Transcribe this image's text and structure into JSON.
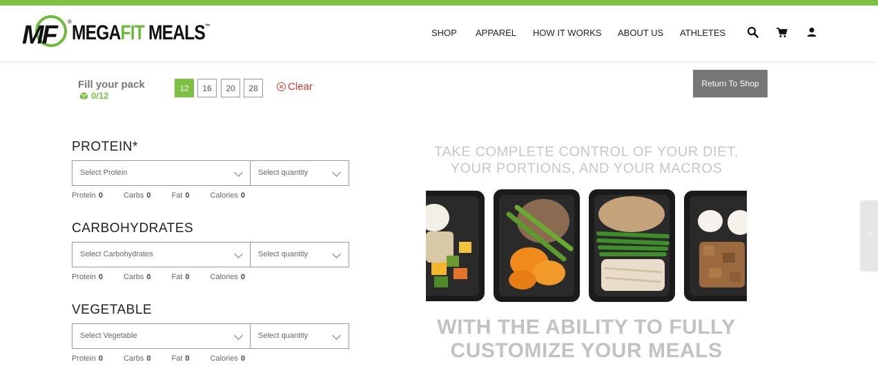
{
  "brand": {
    "name_part1": "MEGA",
    "name_part2": "FIT",
    "name_part3": " MEALS",
    "trademark": "™",
    "mark": "MF",
    "accent": "#7dc142"
  },
  "nav": {
    "items": [
      "SHOP",
      "APPAREL",
      "HOW IT WORKS",
      "ABOUT US",
      "ATHLETES"
    ],
    "icons": [
      "search-icon",
      "cart-icon",
      "user-icon"
    ]
  },
  "pack": {
    "title": "Fill your pack",
    "count": "0/12",
    "sizes": [
      "12",
      "16",
      "20",
      "28"
    ],
    "selected_size": "12",
    "clear_label": "Clear",
    "return_label": "Return To Shop"
  },
  "sections": [
    {
      "title": "PROTEIN*",
      "select_placeholder": "Select Protein",
      "qty_placeholder": "Select quantity",
      "macros": [
        {
          "label": "Protein",
          "value": "0"
        },
        {
          "label": "Carbs",
          "value": "0"
        },
        {
          "label": "Fat",
          "value": "0"
        },
        {
          "label": "Calories",
          "value": "0"
        }
      ]
    },
    {
      "title": "CARBOHYDRATES",
      "select_placeholder": "Select Carbohydrates",
      "qty_placeholder": "Select quantity",
      "macros": [
        {
          "label": "Protein",
          "value": "0"
        },
        {
          "label": "Carbs",
          "value": "0"
        },
        {
          "label": "Fat",
          "value": "0"
        },
        {
          "label": "Calories",
          "value": "0"
        }
      ]
    },
    {
      "title": "VEGETABLE",
      "select_placeholder": "Select Vegetable",
      "qty_placeholder": "Select quantity",
      "macros": [
        {
          "label": "Protein",
          "value": "0"
        },
        {
          "label": "Carbs",
          "value": "0"
        },
        {
          "label": "Fat",
          "value": "0"
        },
        {
          "label": "Calories",
          "value": "0"
        }
      ]
    }
  ],
  "promo": {
    "top_line1": "TAKE COMPLETE CONTROL OF YOUR DIET,",
    "top_line2": "YOUR PORTIONS, AND YOUR MACROS",
    "bottom_line1": "WITH THE ABILITY TO FULLY",
    "bottom_line2": "CUSTOMIZE YOUR MEALS"
  }
}
